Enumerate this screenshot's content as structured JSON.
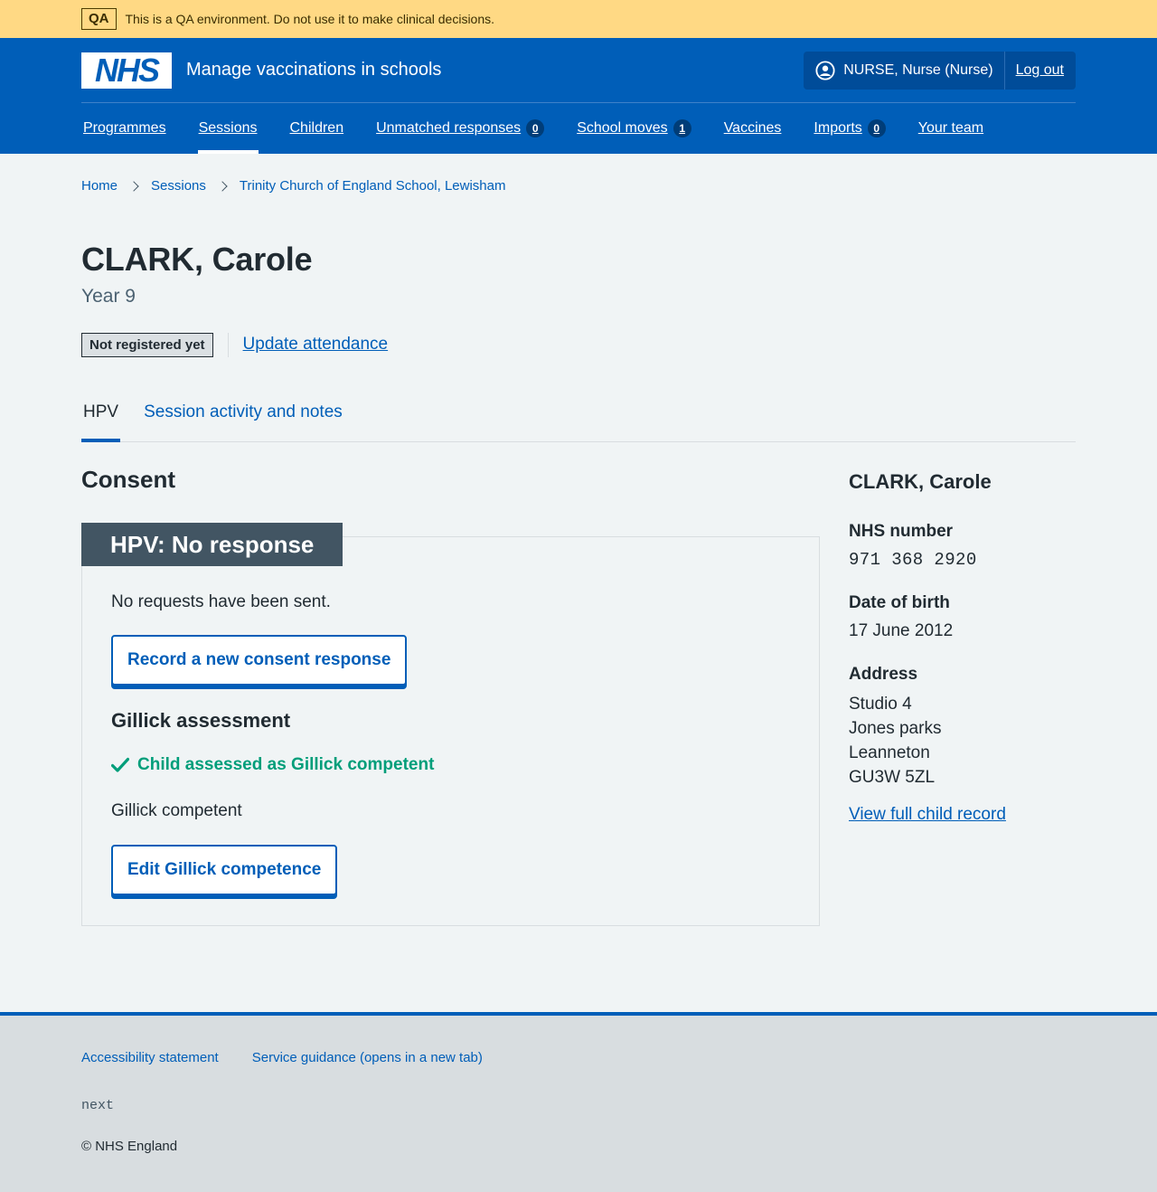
{
  "qa_banner": {
    "tag": "QA",
    "text": "This is a QA environment. Do not use it to make clinical decisions."
  },
  "header": {
    "logo_text": "NHS",
    "service_name": "Manage vaccinations in schools",
    "account": {
      "user_label": "NURSE, Nurse (Nurse)",
      "logout_label": "Log out"
    },
    "nav": [
      {
        "label": "Programmes",
        "count": null,
        "active": false
      },
      {
        "label": "Sessions",
        "count": null,
        "active": true
      },
      {
        "label": "Children",
        "count": null,
        "active": false
      },
      {
        "label": "Unmatched responses",
        "count": "0",
        "active": false
      },
      {
        "label": "School moves",
        "count": "1",
        "active": false
      },
      {
        "label": "Vaccines",
        "count": null,
        "active": false
      },
      {
        "label": "Imports",
        "count": "0",
        "active": false
      },
      {
        "label": "Your team",
        "count": null,
        "active": false
      }
    ]
  },
  "breadcrumb": [
    "Home",
    "Sessions",
    "Trinity Church of England School, Lewisham"
  ],
  "patient": {
    "name": "CLARK, Carole",
    "year": "Year 9",
    "registration_status": "Not registered yet",
    "update_attendance_label": "Update attendance"
  },
  "tabs": [
    {
      "label": "HPV",
      "selected": true
    },
    {
      "label": "Session activity and notes",
      "selected": false
    }
  ],
  "consent": {
    "section_heading": "Consent",
    "card_heading": "HPV: No response",
    "requests_text": "No requests have been sent.",
    "record_button": "Record a new consent response",
    "gillick_heading": "Gillick assessment",
    "gillick_status": "Child assessed as Gillick competent",
    "gillick_text": "Gillick competent",
    "edit_button": "Edit Gillick competence"
  },
  "sidebar": {
    "name": "CLARK, Carole",
    "nhs_number_label": "NHS number",
    "nhs_number": "971 368 2920",
    "dob_label": "Date of birth",
    "dob": "17 June 2012",
    "address_label": "Address",
    "address_lines": [
      "Studio 4",
      "Jones parks",
      "Leanneton",
      "GU3W 5ZL"
    ],
    "view_record_link": "View full child record"
  },
  "footer": {
    "links": [
      "Accessibility statement",
      "Service guidance (opens in a new tab)"
    ],
    "version": "next",
    "copyright": "© NHS England"
  },
  "colors": {
    "nhs_blue": "#005eb8",
    "qa_yellow": "#ffd984",
    "card_heading_bg": "#425563",
    "success_green": "#009e7a"
  }
}
